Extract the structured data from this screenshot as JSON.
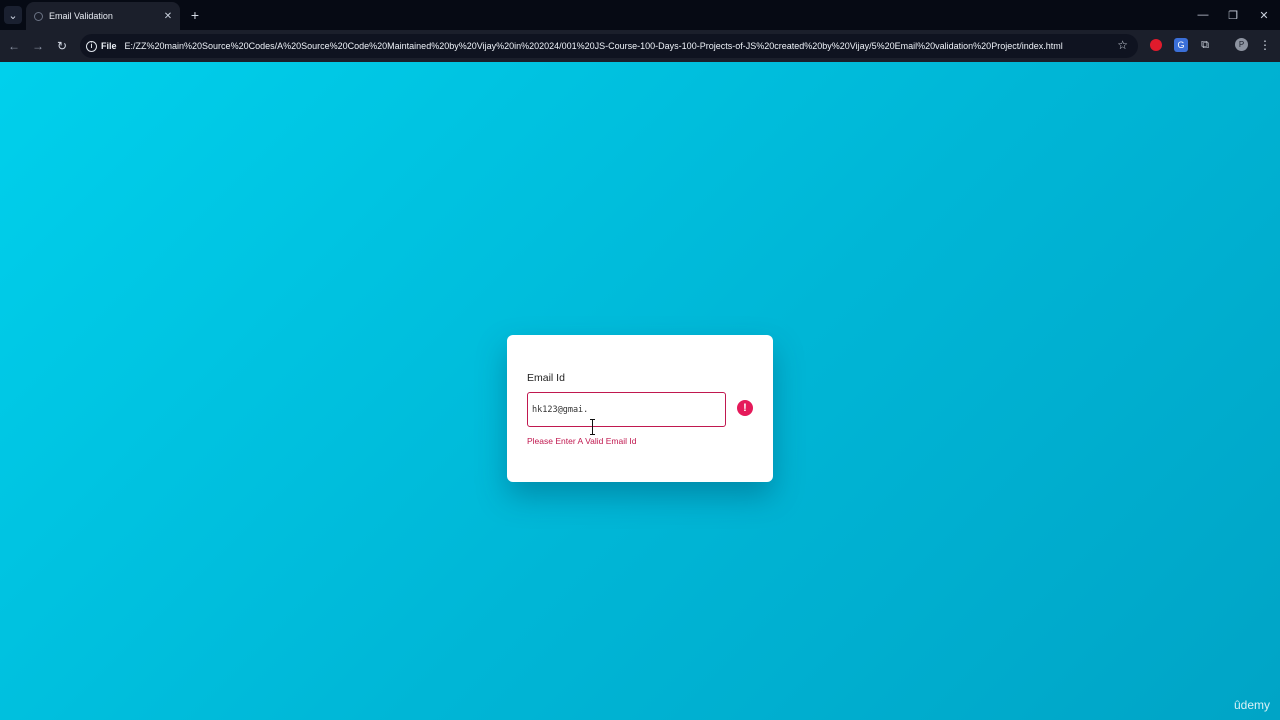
{
  "browser": {
    "tab": {
      "title": "Email Validation",
      "close_icon": "close-icon"
    },
    "new_tab_icon": "plus-icon",
    "window_controls": [
      "minimize-icon",
      "restore-icon",
      "close-icon"
    ],
    "nav": [
      "back-icon",
      "forward-icon",
      "reload-icon"
    ],
    "address": {
      "scheme": "File",
      "url": "E:/ZZ%20main%20Source%20Codes/A%20Source%20Code%20Maintained%20by%20Vijay%20in%202024/001%20JS-Course-100-Days-100-Projects-of-JS%20created%20by%20Vijay/5%20Email%20validation%20Project/index.html"
    },
    "extensions": [
      "record-icon",
      "translate-icon",
      "extensions-icon"
    ],
    "avatar": "P"
  },
  "form": {
    "label": "Email Id",
    "input_value": "hk123@gmai.",
    "error_message": "Please Enter A Valid Email Id",
    "error_icon": "!"
  },
  "watermark": "ûdemy",
  "colors": {
    "background_start": "#00d0ec",
    "background_end": "#00a4c6",
    "error": "#e51a5a",
    "error_text": "#c0184f"
  }
}
